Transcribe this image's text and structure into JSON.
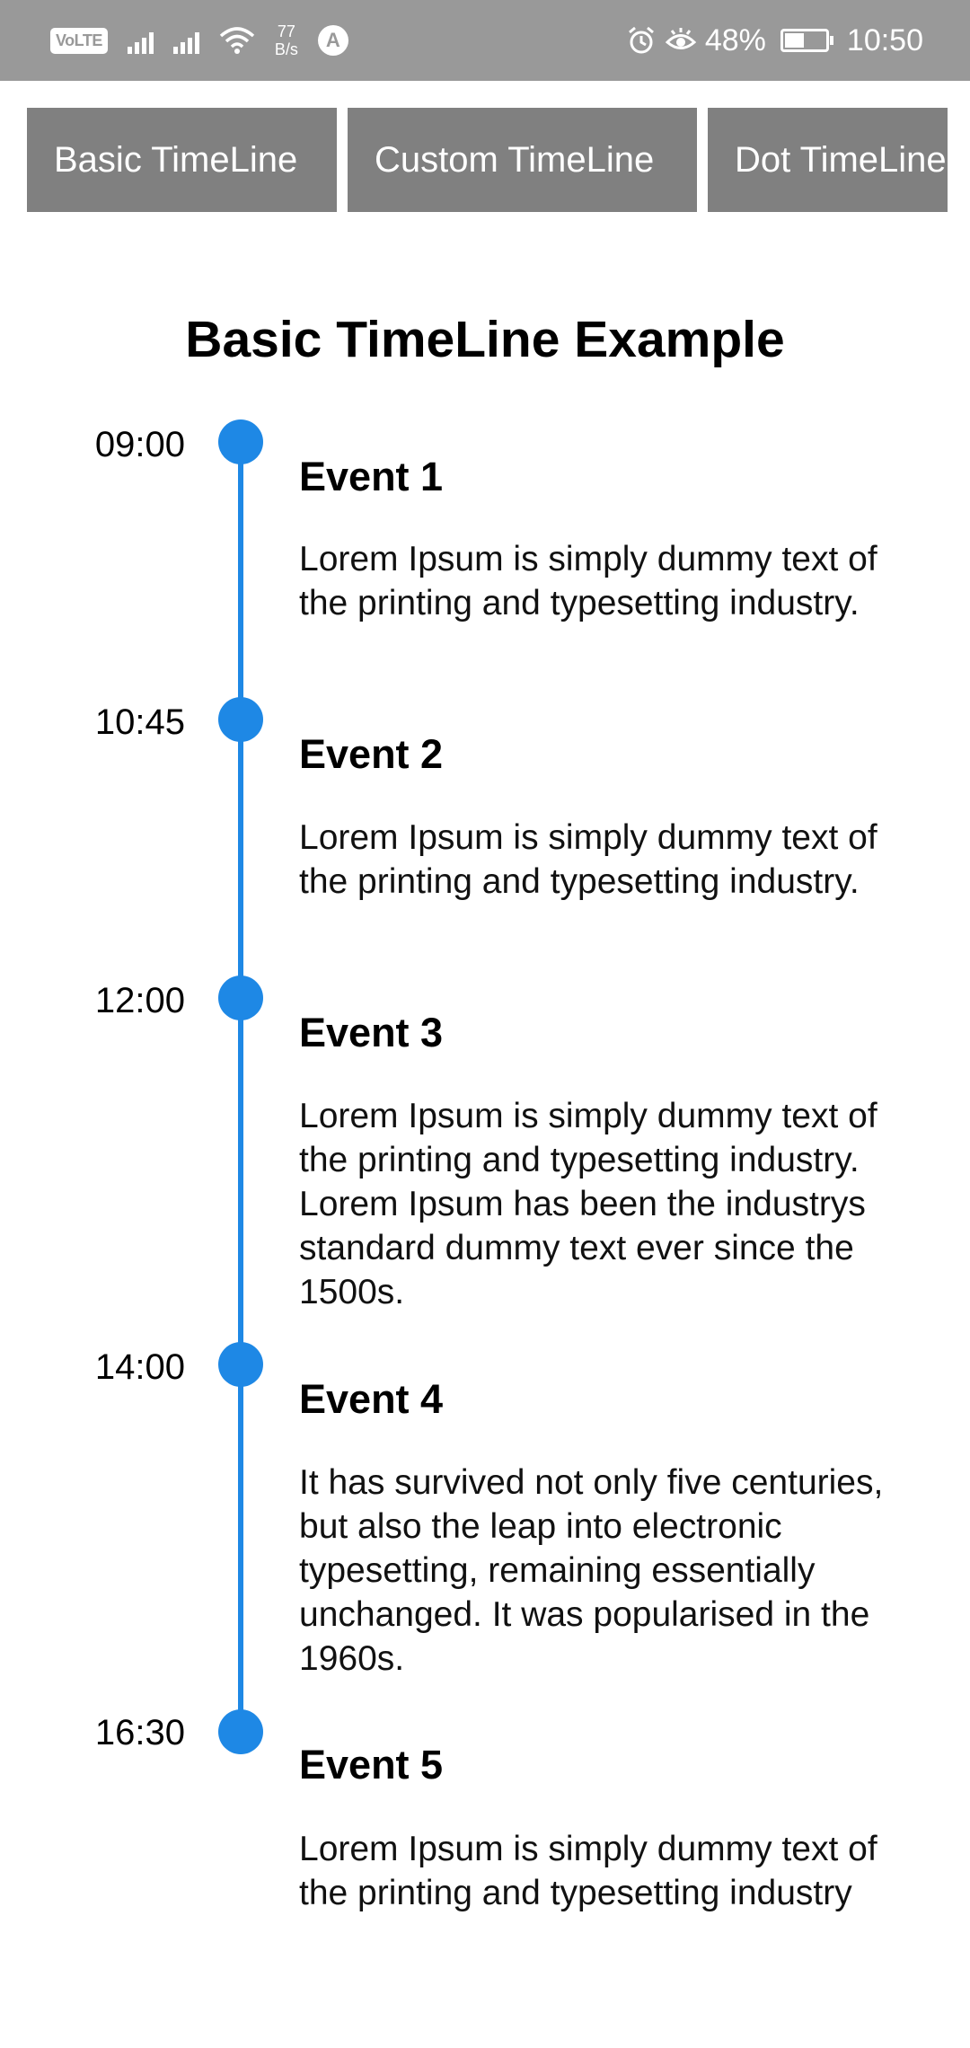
{
  "status_bar": {
    "volte": "VoLTE",
    "net_speed_value": "77",
    "net_speed_unit": "B/s",
    "app_badge": "A",
    "battery": "48%",
    "battery_level": 0.48,
    "time": "10:50"
  },
  "tabs": [
    {
      "label": "Basic TimeLine"
    },
    {
      "label": "Custom TimeLine"
    },
    {
      "label": "Dot TimeLine"
    }
  ],
  "page_title": "Basic TimeLine Example",
  "colors": {
    "timeline_accent": "#1e88e5",
    "tab_background": "#808080",
    "status_bar": "#999999"
  },
  "events": [
    {
      "time": "09:00",
      "title": "Event 1",
      "description": "Lorem Ipsum is simply dummy text of the printing and typesetting industry."
    },
    {
      "time": "10:45",
      "title": "Event 2",
      "description": "Lorem Ipsum is simply dummy text of the printing and typesetting industry."
    },
    {
      "time": "12:00",
      "title": "Event 3",
      "description": "Lorem Ipsum is simply dummy text of the printing and typesetting industry. Lorem Ipsum has been the industrys standard dummy text ever since the 1500s."
    },
    {
      "time": "14:00",
      "title": "Event 4",
      "description": "It has survived not only five centuries, but also the leap into electronic typesetting, remaining essentially unchanged. It was popularised in the 1960s."
    },
    {
      "time": "16:30",
      "title": "Event 5",
      "description": "Lorem Ipsum is simply dummy text of the printing and typesetting industry"
    }
  ]
}
